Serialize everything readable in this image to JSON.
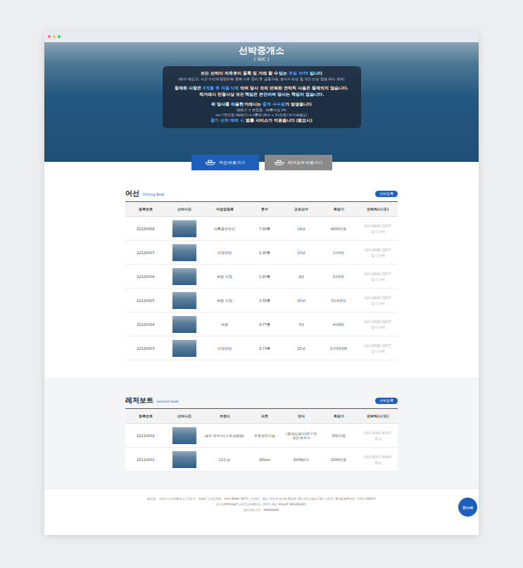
{
  "window": {
    "dots": [
      "#ff6b5f",
      "#ffc23d",
      "#2ecc5a"
    ]
  },
  "hero": {
    "title": "선박중개소",
    "subtitle": "[ SDC ]",
    "paragraphs": [
      [
        {
          "kind": "main",
          "parts": [
            {
              "text": "모든 선박이 자유로이 등록 및 거래 할 수 있는 ",
              "highlight": false
            },
            {
              "text": "유일 SITE",
              "highlight": true
            },
            {
              "text": " 입니다",
              "highlight": false
            }
          ]
        },
        {
          "kind": "note",
          "parts": [
            {
              "text": "(매수·매도인, 시군 수산과 담당자와 함께 서류 정리 후 금융거래, 보이스 피싱 및 개인 신상 정보 처리 유의)",
              "highlight": false
            }
          ]
        }
      ],
      [
        {
          "kind": "main",
          "parts": [
            {
              "text": "등재된 사항은 ",
              "highlight": false
            },
            {
              "text": "3개월 후 자동 삭제",
              "highlight": true
            },
            {
              "text": " 되며 당사 외의 반복된 연락처 사용은 등재되지 않습니다.",
              "highlight": false
            }
          ]
        },
        {
          "kind": "main",
          "parts": [
            {
              "text": "직거래시 민형사상 모든 책임은 본인이며 당사는 책임이 없습니다.",
              "highlight": false
            }
          ]
        }
      ],
      [
        {
          "kind": "main",
          "parts": [
            {
              "text": "위 당사를 이용한 거래시는 ",
              "highlight": false
            },
            {
              "text": "중개 수수료",
              "highlight": true
            },
            {
              "text": "가 발생됩니다",
              "highlight": false
            }
          ]
        },
        {
          "kind": "note",
          "parts": [
            {
              "text": "매매가 X 한정율 , 10톤이상 2%",
              "highlight": false
            }
          ]
        },
        {
          "kind": "note",
          "parts": [
            {
              "text": "(ex.7천만원 (매매가) X 3톤(0.3%)) = 21만원 (부가세별도)",
              "highlight": false
            }
          ]
        },
        {
          "kind": "main",
          "parts": [
            {
              "text": "중기 선박 매매 시",
              "highlight": true
            },
            {
              "text": " 법률 서비스가 지원됩니다 (필요시)",
              "highlight": false
            }
          ]
        }
      ]
    ]
  },
  "nav_buttons": [
    {
      "label": "어선 바로가기",
      "selected": true
    },
    {
      "label": "레저보트 바로가기",
      "selected": false
    }
  ],
  "fishing": {
    "title": "어선",
    "subtitle": "Fishing Boat",
    "button": "선박등록",
    "columns": [
      "등록번호",
      "선박사진",
      "어업업종류",
      "톤수",
      "건조년수",
      "희망가",
      "연락처(시/도)"
    ],
    "rows": [
      {
        "id": "22120008",
        "type": "어획물운반선",
        "ton": "7.93톤",
        "age": "19년",
        "price": "4500만원",
        "phone": "010-8680-3877",
        "region": "경기군현"
      },
      {
        "id": "22120007",
        "type": "자망제망",
        "ton": "2.95톤",
        "age": "10년",
        "price": "1억5천",
        "phone": "010-8680-3877",
        "region": "경기군현"
      },
      {
        "id": "22120006",
        "type": "복합 자망",
        "ton": "1.97톤",
        "age": "2년",
        "price": "1억5천",
        "phone": "010-8680-3877",
        "region": "경기군현"
      },
      {
        "id": "22120005",
        "type": "복합 자망",
        "ton": "3.55톤",
        "age": "20년",
        "price": "1억4천만",
        "phone": "010-8680-3877",
        "region": "경기군현"
      },
      {
        "id": "22120004",
        "type": "복합",
        "ton": "9.77톤",
        "age": "7년",
        "price": "4억8천",
        "phone": "010-8680-3877",
        "region": "경기군현"
      },
      {
        "id": "22120003",
        "type": "자망제망",
        "ton": "2.73톤",
        "age": "22년",
        "price": "1억3천5백",
        "phone": "010-8680-3877",
        "region": "경기군현"
      }
    ]
  },
  "leisure": {
    "title": "레저보트",
    "subtitle": "Leisure boat",
    "button": "선박등록",
    "columns": [
      "등록번호",
      "선박사진",
      "브랜드",
      "피트",
      "연식",
      "희망가",
      "연락처(시/도)"
    ],
    "rows": [
      {
        "id": "22110002",
        "brand": "레저 하우스(가족과함께)",
        "feet": "주문제작가능",
        "year": "(중세도레지)한수연계전 하우스",
        "price": "500만원",
        "phone": "010-2060-4107",
        "region": "충남"
      },
      {
        "id": "22110001",
        "brand": "11인승",
        "feet": "18feet",
        "year": "2008년식",
        "price": "1500만원",
        "phone": "010-8567-4089",
        "region": "충남"
      }
    ]
  },
  "footer": {
    "lines": [
      "회사명 : 선진수산선박중개소 | 대표자 : 송필인 | 대표전화 : 010-8680-3877 | 소재지 : 충남 태안군 태안읍 중앙로 18 우진스빌딩 1층 | 선진도 중개업등록번호 : 2012-WR14",
      "ⓒ COPYRIGHT 선진도선박중개소 2022. ALL RIGHT RESERVED.",
      "관리자로그인 · MAKEWAY"
    ],
    "float_button": "판사세"
  }
}
